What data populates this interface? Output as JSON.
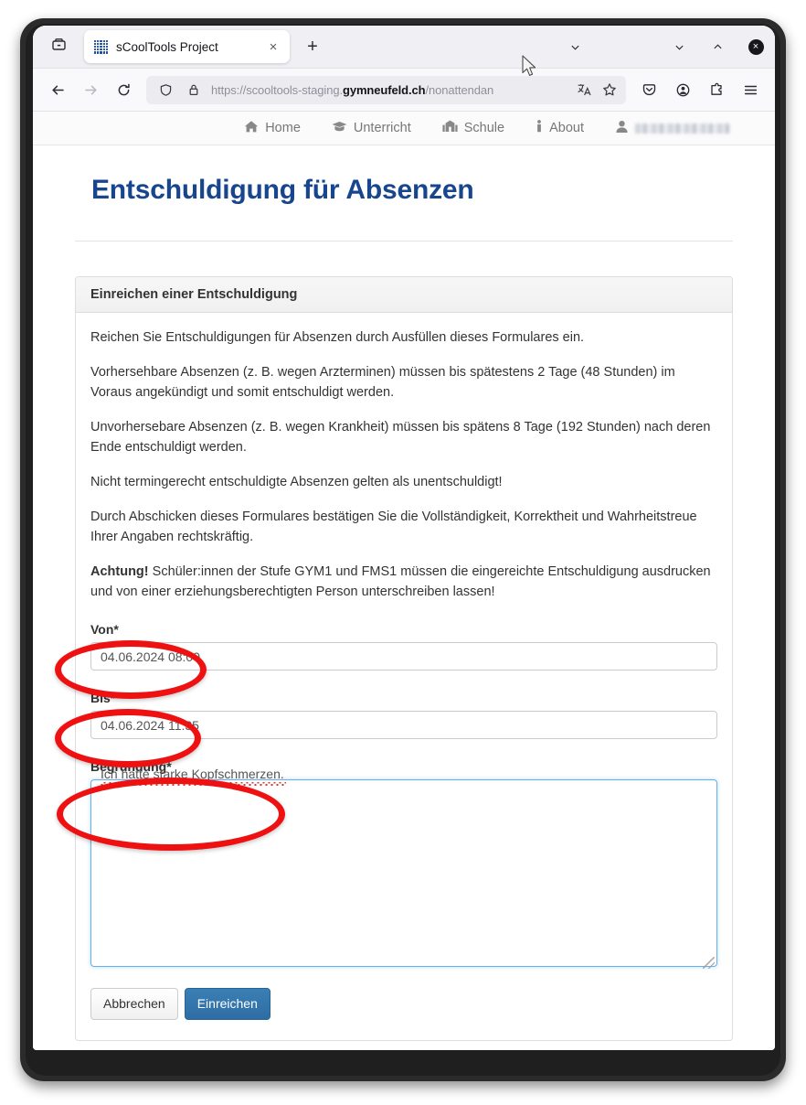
{
  "browser": {
    "tab": {
      "title": "sCoolTools Project",
      "favicon": "dot-grid-icon",
      "close_label": "×"
    },
    "newtab_label": "+",
    "window_controls": {
      "minimize": "⌄",
      "maximize": "⌃",
      "close": "×"
    },
    "url": {
      "prefix": "https://scooltools-staging.",
      "domain": "gymneufeld.ch",
      "path": "/nonattendan",
      "full": "https://scooltools-staging.gymneufeld.ch/nonattendan"
    },
    "toolbar_icons": [
      "back-icon",
      "forward-icon",
      "reload-icon",
      "shield-icon",
      "lock-icon",
      "translate-icon",
      "bookmark-star-icon",
      "pocket-icon",
      "account-icon",
      "extensions-icon",
      "hamburger-menu-icon"
    ]
  },
  "sitenav": {
    "items": [
      {
        "label": "Home",
        "icon": "home-icon"
      },
      {
        "label": "Unterricht",
        "icon": "graduation-cap-icon"
      },
      {
        "label": "Schule",
        "icon": "university-icon"
      },
      {
        "label": "About",
        "icon": "info-icon"
      }
    ],
    "user": {
      "icon": "user-icon",
      "name_redacted": true
    }
  },
  "main": {
    "page_title": "Entschuldigung für Absenzen",
    "card": {
      "header": "Einreichen einer Entschuldigung",
      "paragraphs": [
        "Reichen Sie Entschuldigungen für Absenzen durch Ausfüllen dieses Formulares ein.",
        "Vorhersehbare Absenzen (z. B. wegen Arzterminen) müssen bis spätestens 2 Tage (48 Stunden) im Voraus angekündigt und somit entschuldigt werden.",
        "Unvorhersebare Absenzen (z. B. wegen Krankheit) müssen bis spätens 8 Tage (192 Stunden) nach deren Ende entschuldigt werden.",
        "Nicht termingerecht entschuldigte Absenzen gelten als unentschuldigt!",
        "Durch Abschicken dieses Formulares bestätigen Sie die Vollständigkeit, Korrektheit und Wahrheitstreue Ihrer Angaben rechtskräftig."
      ],
      "warning_prefix": "Achtung!",
      "warning_text": " Schüler:innen der Stufe GYM1 und FMS1 müssen die eingereichte Entschuldigung ausdrucken und von einer erziehungsberechtigten Person unterschreiben lassen!"
    },
    "form": {
      "von": {
        "label": "Von*",
        "value": "04.06.2024 08:00"
      },
      "bis": {
        "label": "Bis*",
        "value": "04.06.2024 11:35"
      },
      "begruendung": {
        "label": "Begründung*",
        "value": "Ich hatte starke Kopfschmerzen."
      },
      "buttons": {
        "cancel": "Abbrechen",
        "submit": "Einreichen"
      }
    }
  },
  "colors": {
    "title_blue": "#17468f",
    "primary_button": "#2e6da4",
    "annotation_red": "#ee1111",
    "favicon_blue": "#1f4d9e"
  }
}
